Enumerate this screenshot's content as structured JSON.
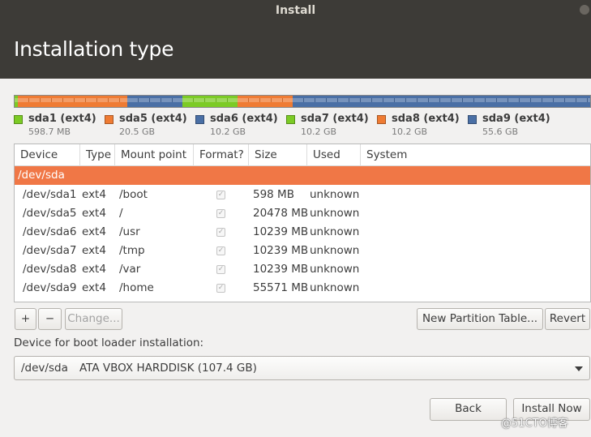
{
  "window": {
    "title": "Install"
  },
  "header": {
    "title": "Installation type"
  },
  "disk_bar": {
    "segments": [
      {
        "name": "sda1",
        "color": "#7ccb25",
        "fraction": 0.0056
      },
      {
        "name": "sda5",
        "color": "#ef7b33",
        "fraction": 0.1907
      },
      {
        "name": "sda6",
        "color": "#4a6fa5",
        "fraction": 0.0954
      },
      {
        "name": "sda7",
        "color": "#7ccb25",
        "fraction": 0.0954
      },
      {
        "name": "sda8",
        "color": "#ef7b33",
        "fraction": 0.0954
      },
      {
        "name": "sda9",
        "color": "#4a6fa5",
        "fraction": 0.5175
      }
    ]
  },
  "legend": [
    {
      "label": "sda1 (ext4)",
      "size": "598.7 MB",
      "color": "#7ccb25"
    },
    {
      "label": "sda5 (ext4)",
      "size": "20.5 GB",
      "color": "#ef7b33"
    },
    {
      "label": "sda6 (ext4)",
      "size": "10.2 GB",
      "color": "#4a6fa5"
    },
    {
      "label": "sda7 (ext4)",
      "size": "10.2 GB",
      "color": "#7ccb25"
    },
    {
      "label": "sda8 (ext4)",
      "size": "10.2 GB",
      "color": "#ef7b33"
    },
    {
      "label": "sda9 (ext4)",
      "size": "55.6 GB",
      "color": "#4a6fa5"
    }
  ],
  "table": {
    "columns": [
      "Device",
      "Type",
      "Mount point",
      "Format?",
      "Size",
      "Used",
      "System"
    ],
    "disk_row": {
      "device": "/dev/sda"
    },
    "rows": [
      {
        "device": "/dev/sda1",
        "type": "ext4",
        "mount": "/boot",
        "format": true,
        "size": "598 MB",
        "used": "unknown",
        "system": ""
      },
      {
        "device": "/dev/sda5",
        "type": "ext4",
        "mount": "/",
        "format": true,
        "size": "20478 MB",
        "used": "unknown",
        "system": ""
      },
      {
        "device": "/dev/sda6",
        "type": "ext4",
        "mount": "/usr",
        "format": true,
        "size": "10239 MB",
        "used": "unknown",
        "system": ""
      },
      {
        "device": "/dev/sda7",
        "type": "ext4",
        "mount": "/tmp",
        "format": true,
        "size": "10239 MB",
        "used": "unknown",
        "system": ""
      },
      {
        "device": "/dev/sda8",
        "type": "ext4",
        "mount": "/var",
        "format": true,
        "size": "10239 MB",
        "used": "unknown",
        "system": ""
      },
      {
        "device": "/dev/sda9",
        "type": "ext4",
        "mount": "/home",
        "format": true,
        "size": "55571 MB",
        "used": "unknown",
        "system": ""
      }
    ]
  },
  "partition_buttons": {
    "add": "+",
    "remove": "−",
    "change": "Change..."
  },
  "table_buttons": {
    "new_table": "New Partition Table...",
    "revert": "Revert"
  },
  "bootloader": {
    "label": "Device for boot loader installation:",
    "device": "/dev/sda",
    "description": "ATA VBOX HARDDISK (107.4 GB)"
  },
  "nav": {
    "back": "Back",
    "install": "Install Now"
  },
  "watermark": "@51CTO博客",
  "colors": {
    "selection": "#f07746",
    "header_bg": "#3d3b37"
  }
}
